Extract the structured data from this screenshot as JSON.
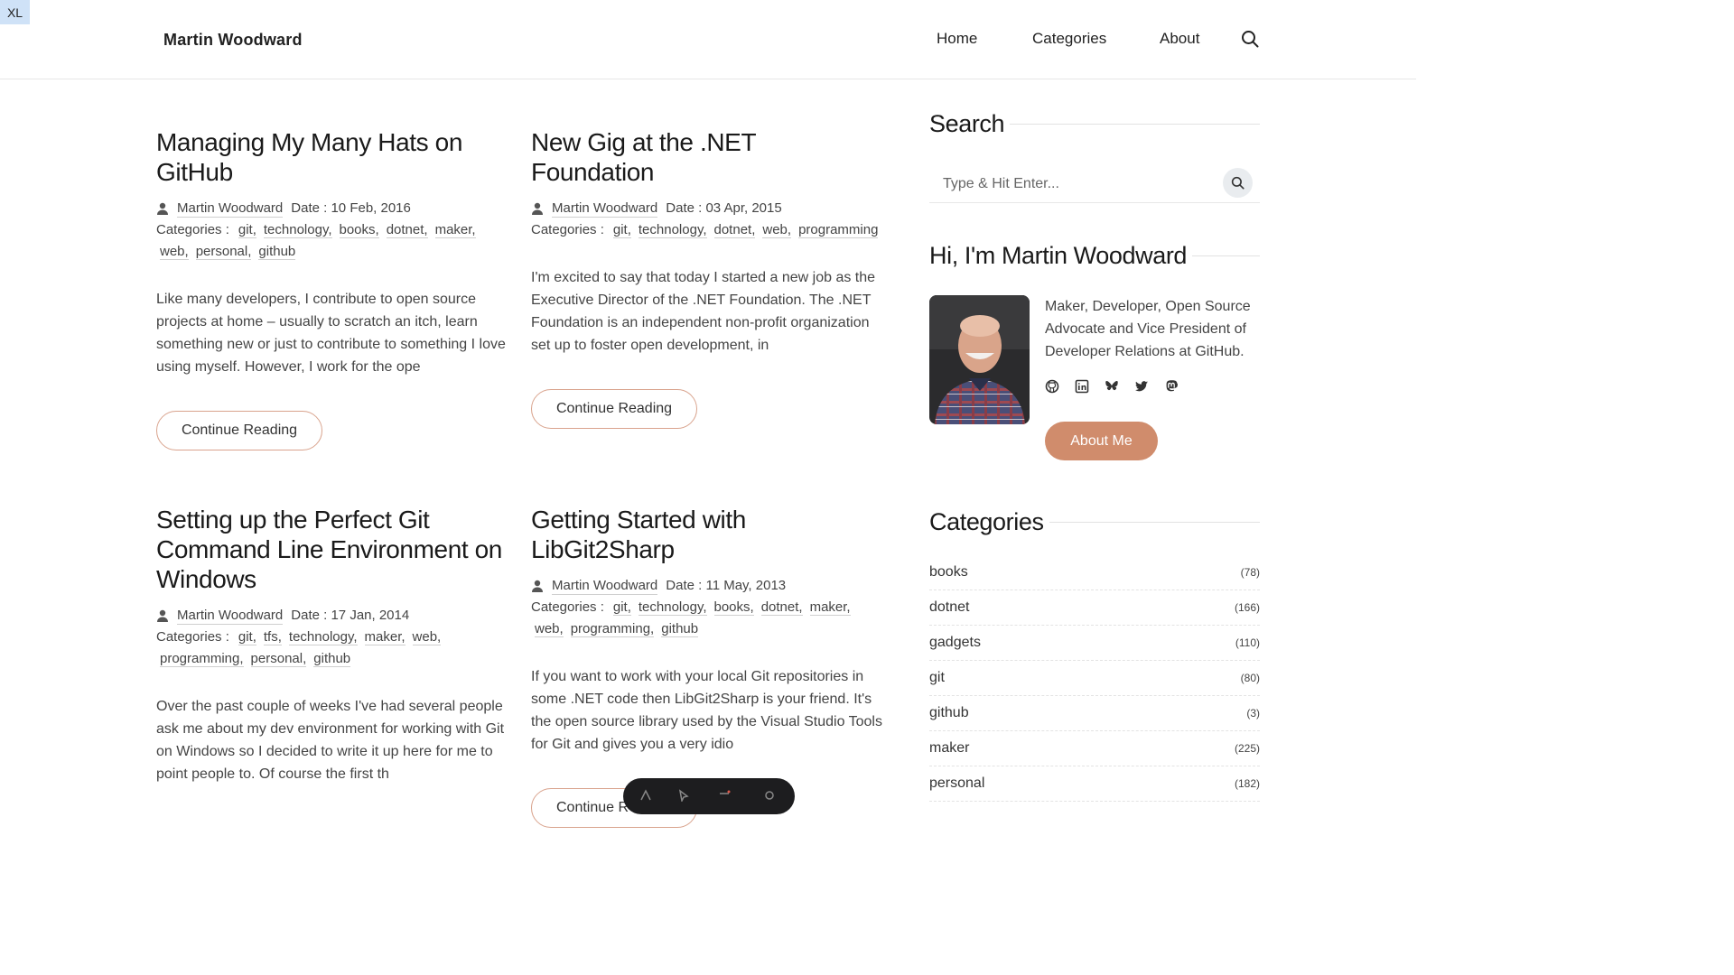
{
  "breakpoint_badge": "XL",
  "header": {
    "site_title": "Martin Woodward",
    "nav": [
      {
        "label": "Home"
      },
      {
        "label": "Categories"
      },
      {
        "label": "About"
      }
    ],
    "search_icon": "search-icon"
  },
  "posts": [
    {
      "title": "Managing My Many Hats on GitHub",
      "author": "Martin Woodward",
      "date_label": "Date : 10 Feb, 2016",
      "categories_label": "Categories :",
      "categories": [
        "git,",
        "technology,",
        "books,",
        "dotnet,",
        "maker,",
        "web,",
        "personal,",
        "github"
      ],
      "excerpt": "Like many developers, I contribute to open source projects at home – usually to scratch an itch, learn something new or just to contribute to something I love using myself. However, I work for the ope",
      "button": "Continue Reading"
    },
    {
      "title": "New Gig at the .NET Foundation",
      "author": "Martin Woodward",
      "date_label": "Date : 03 Apr, 2015",
      "categories_label": "Categories :",
      "categories": [
        "git,",
        "technology,",
        "dotnet,",
        "web,",
        "programming"
      ],
      "excerpt": "I'm excited to say that today I started a new job as the Executive Director of the .NET Foundation. The .NET Foundation is an independent non-profit organization set up to foster open development, in",
      "button": "Continue Reading"
    },
    {
      "title": "Setting up the Perfect Git Command Line Environment on Windows",
      "author": "Martin Woodward",
      "date_label": "Date : 17 Jan, 2014",
      "categories_label": "Categories :",
      "categories": [
        "git,",
        "tfs,",
        "technology,",
        "maker,",
        "web,",
        "programming,",
        "personal,",
        "github"
      ],
      "excerpt": "Over the past couple of weeks I've had several people ask me about my dev environment for working with Git on Windows so I decided to write it up here for me to point people to. Of course the first th",
      "button": "Continue Reading"
    },
    {
      "title": "Getting Started with LibGit2Sharp",
      "author": "Martin Woodward",
      "date_label": "Date : 11 May, 2013",
      "categories_label": "Categories :",
      "categories": [
        "git,",
        "technology,",
        "books,",
        "dotnet,",
        "maker,",
        "web,",
        "programming,",
        "github"
      ],
      "excerpt": "If you want to work with your local Git repositories in some .NET code then LibGit2Sharp is your friend. It's the open source library used by the Visual Studio Tools for Git and gives you a very idio",
      "button": "Continue R"
    }
  ],
  "sidebar": {
    "search": {
      "title": "Search",
      "placeholder": "Type & Hit Enter..."
    },
    "about": {
      "title": "Hi, I'm Martin Woodward",
      "bio": "Maker, Developer, Open Source Advocate and Vice President of Developer Relations at GitHub.",
      "social": [
        "github-icon",
        "linkedin-icon",
        "bluesky-icon",
        "twitter-icon",
        "mastodon-icon"
      ],
      "button": "About Me",
      "accent_color": "#d08c6c"
    },
    "categories": {
      "title": "Categories",
      "items": [
        {
          "name": "books",
          "count": "(78)"
        },
        {
          "name": "dotnet",
          "count": "(166)"
        },
        {
          "name": "gadgets",
          "count": "(110)"
        },
        {
          "name": "git",
          "count": "(80)"
        },
        {
          "name": "github",
          "count": "(3)"
        },
        {
          "name": "maker",
          "count": "(225)"
        },
        {
          "name": "personal",
          "count": "(182)"
        }
      ]
    }
  }
}
